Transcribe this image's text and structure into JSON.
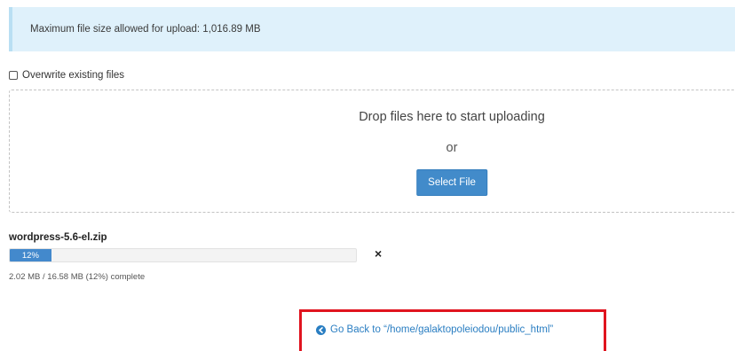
{
  "upload_info": {
    "max_size_text": "Maximum file size allowed for upload: 1,016.89 MB"
  },
  "options": {
    "overwrite_label": "Overwrite existing files",
    "overwrite_checked": false
  },
  "drop_zone": {
    "title": "Drop files here to start uploading",
    "or_text": "or",
    "select_button_label": "Select File"
  },
  "upload": {
    "file_name": "wordpress-5.6-el.zip",
    "progress_label": "12%",
    "progress_fraction": 0.12,
    "cancel_glyph": "×",
    "status_text": "2.02 MB / 16.58 MB (12%) complete"
  },
  "navigation": {
    "go_back_label": "Go Back to “/home/galaktopoleiodou/public_html”",
    "link_color": "#2a7ec2",
    "highlight_color": "#e0141f"
  }
}
